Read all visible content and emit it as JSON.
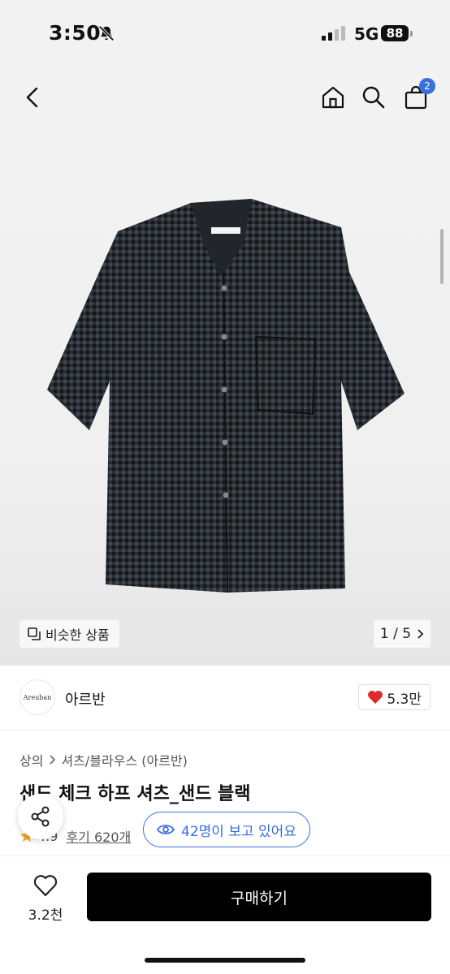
{
  "status_bar": {
    "time": "3:50",
    "network": "5G",
    "battery": "88"
  },
  "header": {
    "cart_count": "2"
  },
  "gallery": {
    "similar_label": "비슷한 상품",
    "pager": "1 / 5"
  },
  "brand": {
    "logo_text": "Areuban",
    "name": "아르반",
    "likes": "5.3만"
  },
  "product": {
    "breadcrumb": [
      "상의",
      "셔츠/블라우스 (아르반)"
    ],
    "title": "샌드 체크 하프 셔츠_샌드 블랙",
    "rating": "4.9",
    "reviews": "후기 620개",
    "viewers": "42명이 보고 있어요"
  },
  "bottom": {
    "wish_count": "3.2천",
    "buy_label": "구매하기"
  },
  "colors": {
    "accent": "#3a6fe0",
    "heart": "#e0282e",
    "star": "#f5a623"
  }
}
